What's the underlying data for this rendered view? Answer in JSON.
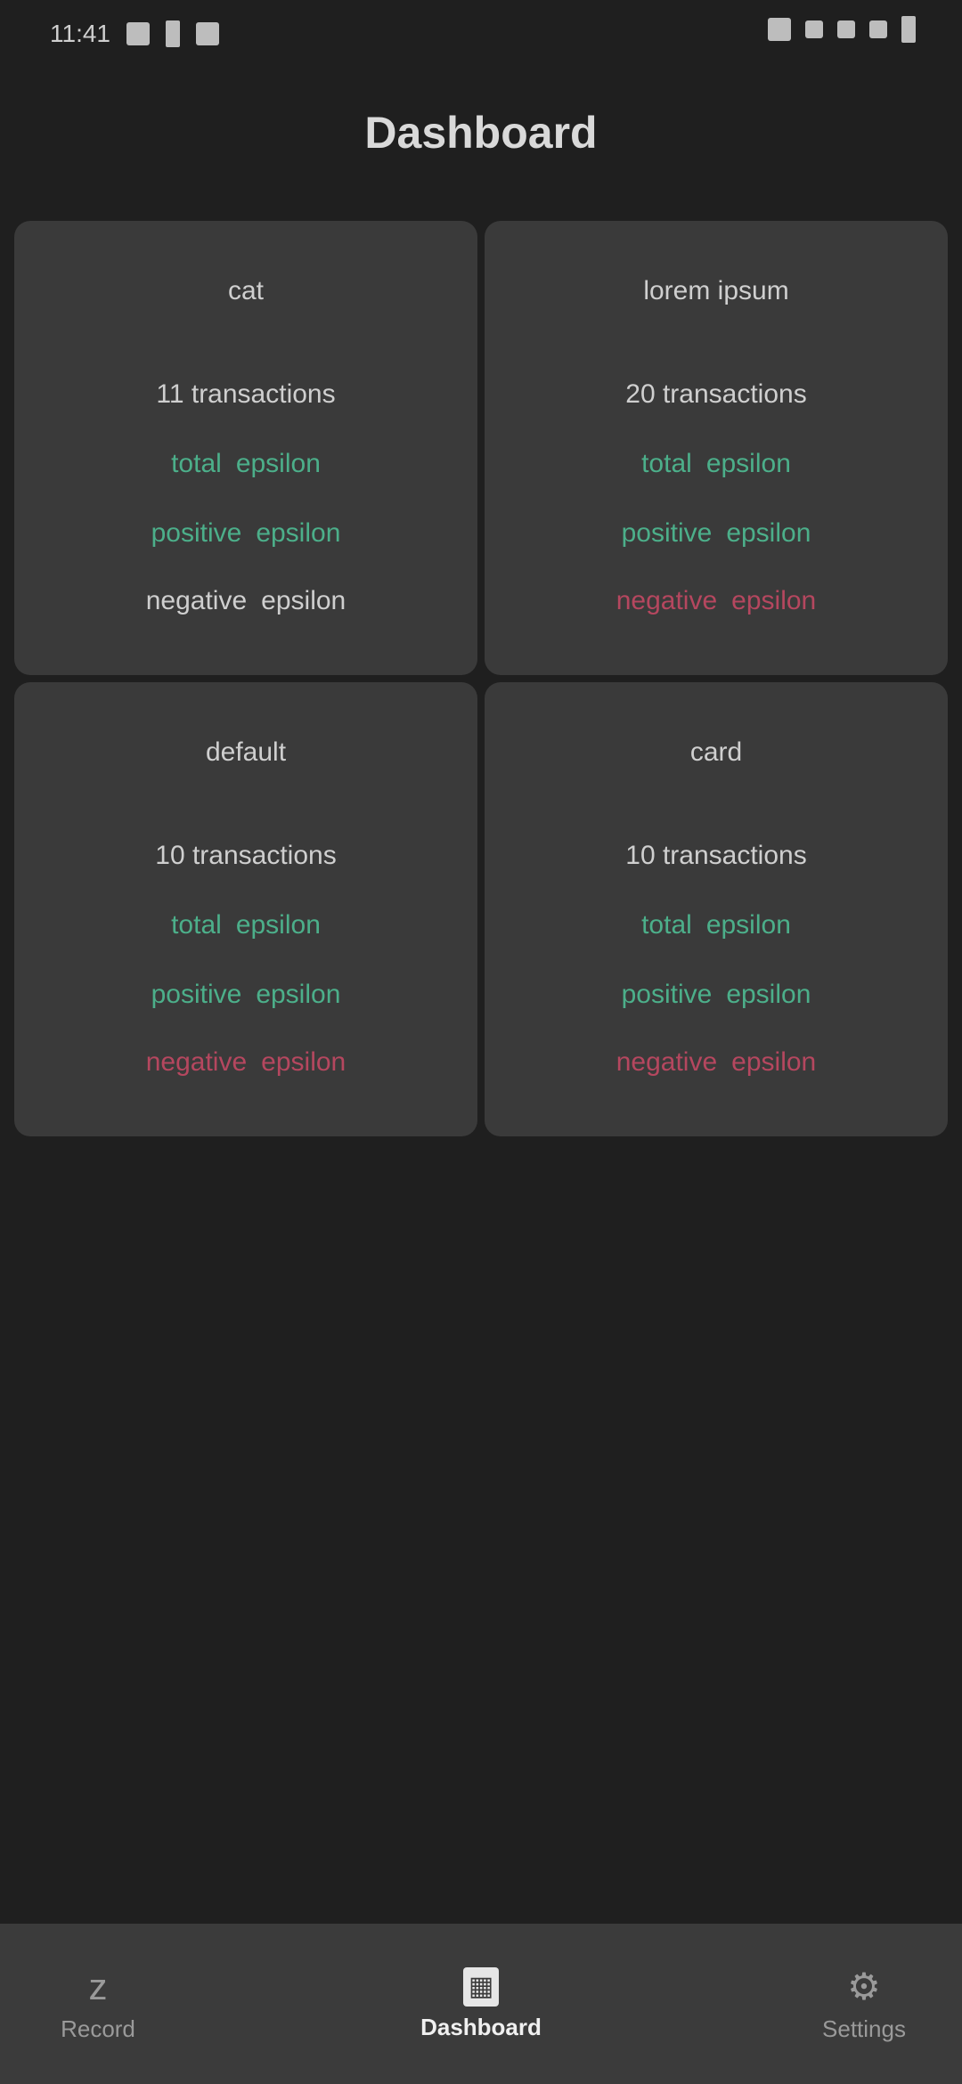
{
  "status_bar": {
    "time": "11:41",
    "left_icons": [
      "sim-icon",
      "battery-saver-icon",
      "notification-icon"
    ],
    "right_icons": [
      "wifi-icon",
      "data-icon",
      "nfc-icon",
      "signal-icon",
      "battery-icon"
    ]
  },
  "header": {
    "title": "Dashboard"
  },
  "cards": [
    {
      "title": "cat",
      "transactions": "11 transactions",
      "total_label": "total",
      "total_value": "epsilon",
      "positive_label": "positive",
      "positive_value": "epsilon",
      "negative_label": "negative",
      "negative_value": "epsilon",
      "negative_style": "neutral"
    },
    {
      "title": "lorem ipsum",
      "transactions": "20 transactions",
      "total_label": "total",
      "total_value": "epsilon",
      "positive_label": "positive",
      "positive_value": "epsilon",
      "negative_label": "negative",
      "negative_value": "epsilon",
      "negative_style": "neg"
    },
    {
      "title": "default",
      "transactions": "10 transactions",
      "total_label": "total",
      "total_value": "epsilon",
      "positive_label": "positive",
      "positive_value": "epsilon",
      "negative_label": "negative",
      "negative_value": "epsilon",
      "negative_style": "neg"
    },
    {
      "title": "card",
      "transactions": "10 transactions",
      "total_label": "total",
      "total_value": "epsilon",
      "positive_label": "positive",
      "positive_value": "epsilon",
      "negative_label": "negative",
      "negative_value": "epsilon",
      "negative_style": "neg"
    }
  ],
  "bottom_nav": {
    "items": [
      {
        "label": "Record",
        "icon": "z",
        "active": false
      },
      {
        "label": "Dashboard",
        "icon": "▦",
        "active": true
      },
      {
        "label": "Settings",
        "icon": "⚙",
        "active": false
      }
    ]
  },
  "colors": {
    "background": "#1f1f1f",
    "card": "#3a3a3a",
    "positive": "#4caf8a",
    "negative": "#b5475f",
    "nav": "#3b3b3b"
  }
}
